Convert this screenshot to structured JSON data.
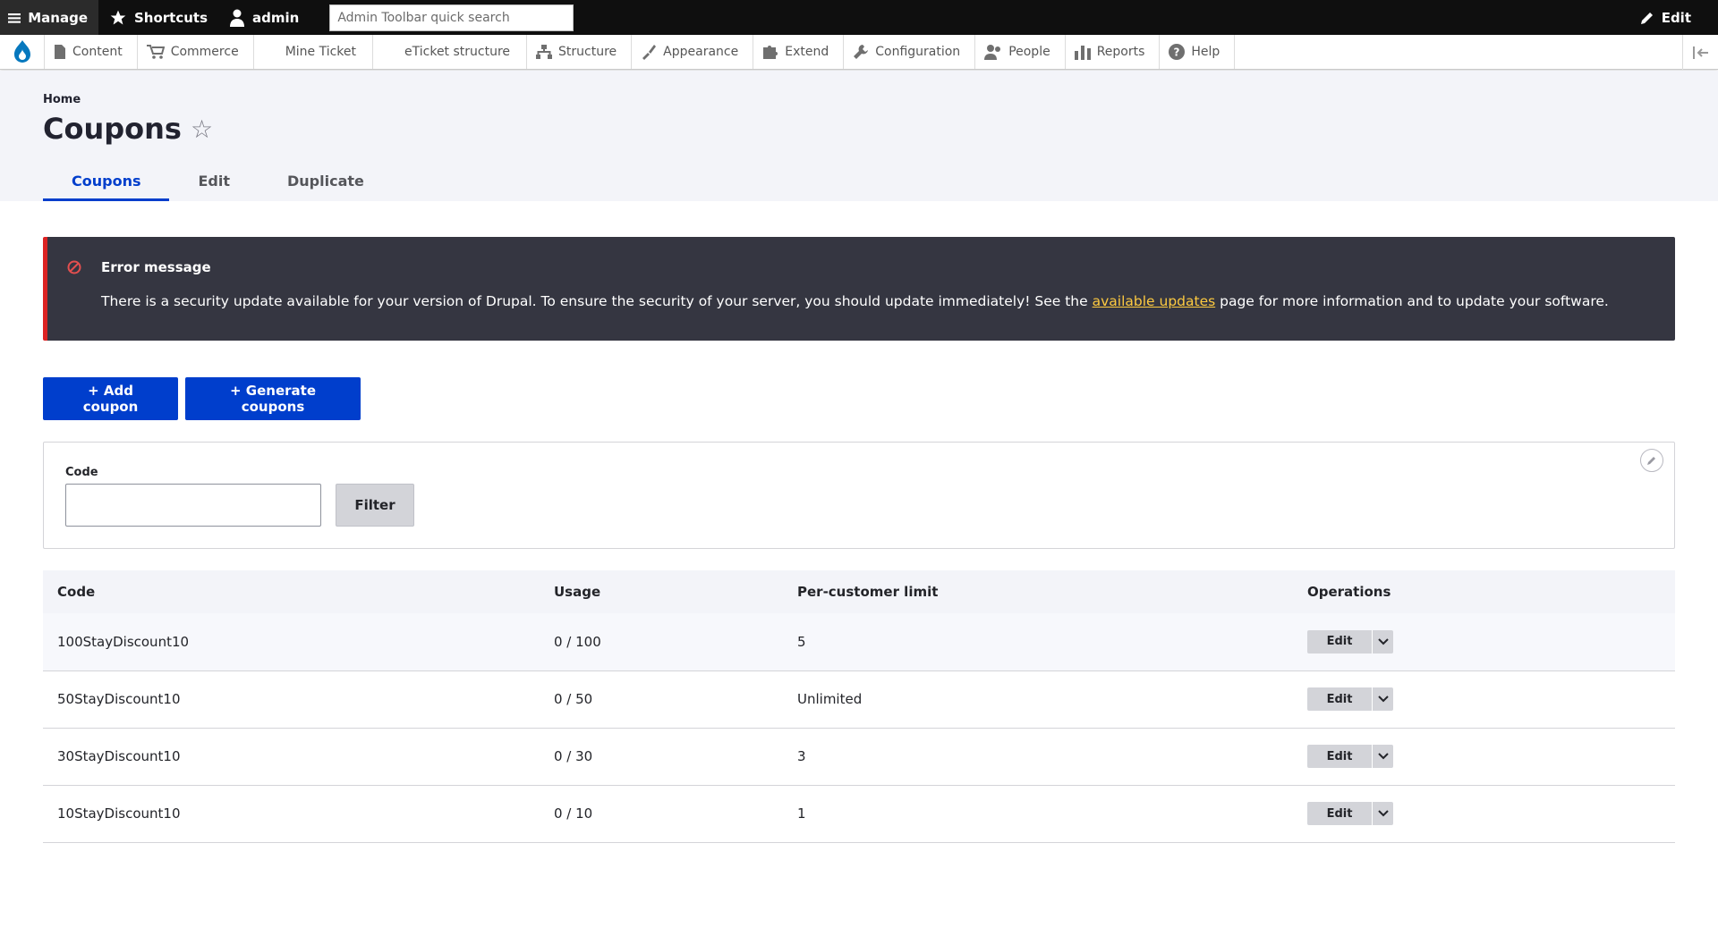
{
  "toolbar": {
    "manage_label": "Manage",
    "shortcuts_label": "Shortcuts",
    "user_label": "admin",
    "search_placeholder": "Admin Toolbar quick search",
    "edit_label": "Edit"
  },
  "tray": {
    "items": [
      {
        "label": "Content",
        "icon": "file-icon"
      },
      {
        "label": "Commerce",
        "icon": "cart-icon"
      },
      {
        "label": "Mine Ticket",
        "icon": ""
      },
      {
        "label": "eTicket structure",
        "icon": ""
      },
      {
        "label": "Structure",
        "icon": "sitemap-icon"
      },
      {
        "label": "Appearance",
        "icon": "paintbrush-icon"
      },
      {
        "label": "Extend",
        "icon": "puzzle-icon"
      },
      {
        "label": "Configuration",
        "icon": "wrench-icon"
      },
      {
        "label": "People",
        "icon": "people-icon"
      },
      {
        "label": "Reports",
        "icon": "bar-chart-icon"
      },
      {
        "label": "Help",
        "icon": "help-icon"
      }
    ]
  },
  "header": {
    "breadcrumb": "Home",
    "title": "Coupons",
    "tabs": [
      {
        "label": "Coupons",
        "active": true
      },
      {
        "label": "Edit",
        "active": false
      },
      {
        "label": "Duplicate",
        "active": false
      }
    ]
  },
  "message": {
    "title": "Error message",
    "text_before": "There is a security update available for your version of Drupal. To ensure the security of your server, you should update immediately! See the ",
    "link_text": "available updates",
    "text_after": " page for more information and to update your software."
  },
  "actions": {
    "add_label": "+ Add coupon",
    "generate_label": "+ Generate coupons"
  },
  "filter": {
    "code_label": "Code",
    "code_value": "",
    "filter_button": "Filter"
  },
  "table": {
    "headers": [
      "Code",
      "Usage",
      "Per-customer limit",
      "Operations"
    ],
    "rows": [
      {
        "code": "100StayDiscount10",
        "usage": "0 / 100",
        "limit": "5",
        "op": "Edit"
      },
      {
        "code": "50StayDiscount10",
        "usage": "0 / 50",
        "limit": "Unlimited",
        "op": "Edit"
      },
      {
        "code": "30StayDiscount10",
        "usage": "0 / 30",
        "limit": "3",
        "op": "Edit"
      },
      {
        "code": "10StayDiscount10",
        "usage": "0 / 10",
        "limit": "1",
        "op": "Edit"
      }
    ]
  },
  "colors": {
    "primary": "#003ecc",
    "toolbar_bg": "#0f0f0f",
    "error_border": "#dc2323",
    "message_bg": "#353641",
    "link_yellow": "#fdca40"
  }
}
